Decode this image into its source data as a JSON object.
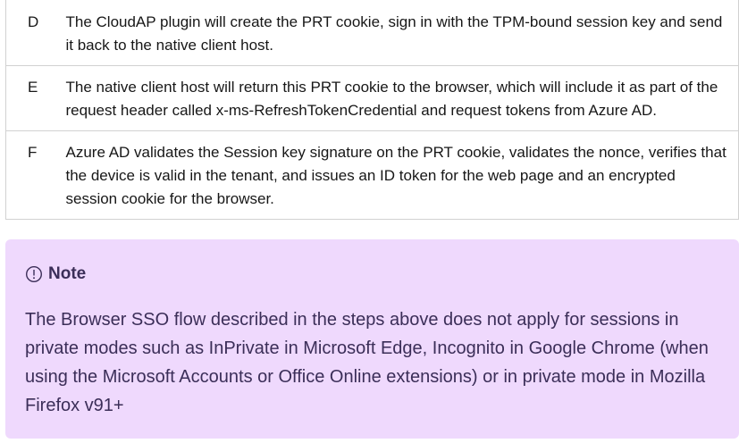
{
  "steps": [
    {
      "letter": "D",
      "text": "The CloudAP plugin will create the PRT cookie, sign in with the TPM-bound session key and send it back to the native client host."
    },
    {
      "letter": "E",
      "text": "The native client host will return this PRT cookie to the browser, which will include it as part of the request header called x-ms-RefreshTokenCredential and request tokens from Azure AD."
    },
    {
      "letter": "F",
      "text": "Azure AD validates the Session key signature on the PRT cookie, validates the nonce, verifies that the device is valid in the tenant, and issues an ID token for the web page and an encrypted session cookie for the browser."
    }
  ],
  "note": {
    "icon": "info-circle-icon",
    "title": "Note",
    "body": "The Browser SSO flow described in the steps above does not apply for sessions in private modes such as InPrivate in Microsoft Edge, Incognito in Google Chrome (when using the Microsoft Accounts or Office Online extensions) or in private mode in Mozilla Firefox v91+"
  },
  "colors": {
    "note_background": "#efd9fd",
    "note_text": "#3b2e58",
    "table_border": "#d1d1d1",
    "body_text": "#171717"
  }
}
